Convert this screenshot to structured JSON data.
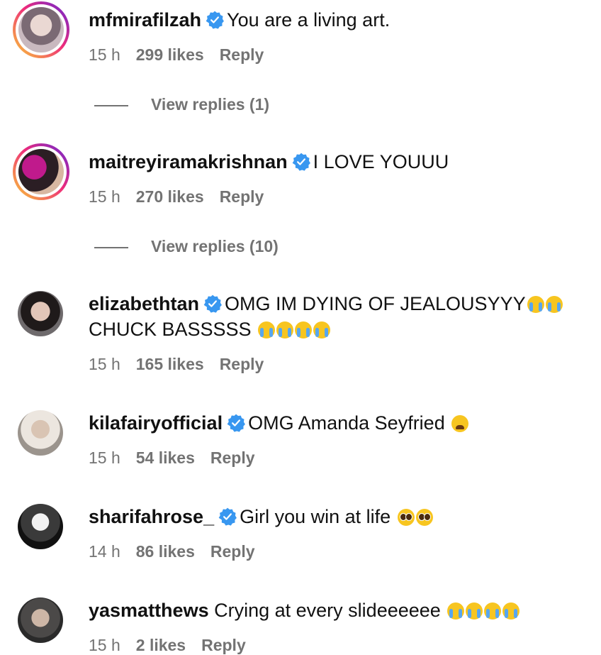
{
  "comments": [
    {
      "username": "mfmirafilzah",
      "verified": true,
      "text": "You are a living art.",
      "time": "15 h",
      "likes": "299 likes",
      "reply": "Reply",
      "view_replies": "View replies (1)",
      "avatar_ring": true
    },
    {
      "username": "maitreyiramakrishnan",
      "verified": true,
      "text": "I LOVE YOUUU",
      "time": "15 h",
      "likes": "270 likes",
      "reply": "Reply",
      "view_replies": "View replies (10)",
      "avatar_ring": true
    },
    {
      "username": "elizabethtan",
      "verified": true,
      "text": "OMG IM DYING OF JEALOUSYYY",
      "text_line2": "CHUCK BASSSSS",
      "emoji1": "loudly-crying-face x2",
      "emoji2": "loudly-crying-face x4",
      "time": "15 h",
      "likes": "165 likes",
      "reply": "Reply"
    },
    {
      "username": "kilafairyofficial",
      "verified": true,
      "text": "OMG Amanda Seyfried",
      "emoji1": "weary-face",
      "time": "15 h",
      "likes": "54 likes",
      "reply": "Reply"
    },
    {
      "username": "sharifahrose_",
      "verified": true,
      "text": "Girl you win at life",
      "emoji1": "pleading-face x2",
      "time": "14 h",
      "likes": "86 likes",
      "reply": "Reply"
    },
    {
      "username": "yasmatthews",
      "verified": false,
      "text": "Crying at every slideeeeee",
      "emoji1": "loudly-crying-face x4",
      "time": "15 h",
      "likes": "2 likes",
      "reply": "Reply"
    }
  ],
  "colors": {
    "verified_badge": "#3897f0",
    "meta_text": "#737373",
    "story_ring_start": "#f9ce34",
    "story_ring_end": "#6228d7"
  }
}
